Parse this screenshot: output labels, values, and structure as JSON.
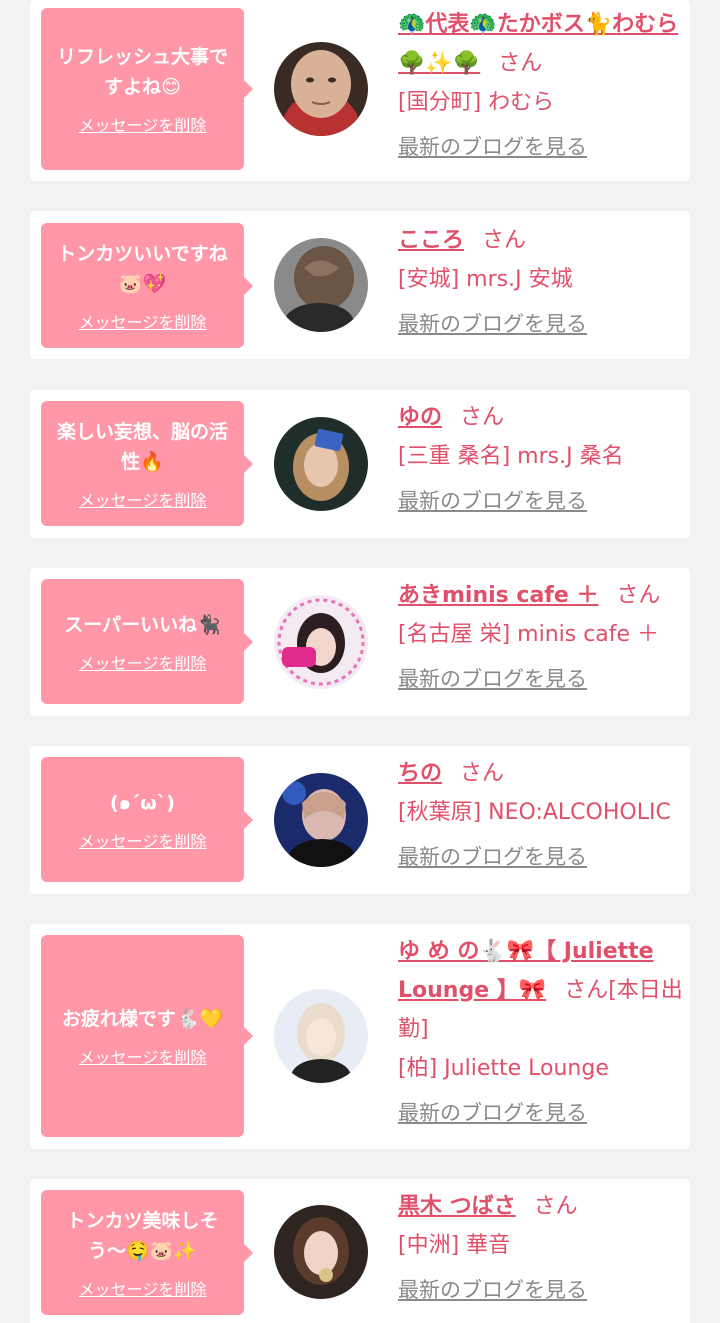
{
  "cards": [
    {
      "message": "リフレッシュ大事ですよね😊",
      "delete_label": "メッセージを削除",
      "name": "🦚代表🦚たかボス🐈わむら🌳✨🌳",
      "honorific": "さん",
      "shop": "[国分町] わむら",
      "blog_label": "最新のブログを見る",
      "avatar_icon": "avatar-photo"
    },
    {
      "message": "トンカツいいですね🐷💖",
      "delete_label": "メッセージを削除",
      "name": "こころ",
      "honorific": "さん",
      "shop": "[安城] mrs.J 安城",
      "blog_label": "最新のブログを見る",
      "avatar_icon": "avatar-photo"
    },
    {
      "message": "楽しい妄想、脳の活性🔥",
      "delete_label": "メッセージを削除",
      "name": "ゆの",
      "honorific": "さん",
      "shop": "[三重 桑名] mrs.J 桑名",
      "blog_label": "最新のブログを見る",
      "avatar_icon": "avatar-photo"
    },
    {
      "message": "スーパーいいね🐈‍⬛",
      "delete_label": "メッセージを削除",
      "name": "あきminis cafe ＋",
      "honorific": "さん",
      "shop": "[名古屋 栄] minis cafe ＋",
      "blog_label": "最新のブログを見る",
      "avatar_icon": "avatar-photo"
    },
    {
      "message": "(๑´ω`)",
      "delete_label": "メッセージを削除",
      "name": "ちの",
      "honorific": "さん",
      "shop": "[秋葉原] NEO:ALCOHOLIC",
      "blog_label": "最新のブログを見る",
      "avatar_icon": "avatar-photo"
    },
    {
      "message": "お疲れ様です🐇💛",
      "delete_label": "メッセージを削除",
      "name": "ゆ め の🐇🎀【 Juliette Lounge 】🎀",
      "honorific": "さん[本日出勤]",
      "shop": "[柏] Juliette Lounge",
      "blog_label": "最新のブログを見る",
      "avatar_icon": "avatar-photo"
    },
    {
      "message": "トンカツ美味しそう〜🤤🐷✨",
      "delete_label": "メッセージを削除",
      "name": "黒木 つばさ",
      "honorific": "さん",
      "shop": "[中洲] 華音",
      "blog_label": "最新のブログを見る",
      "avatar_icon": "avatar-photo"
    }
  ],
  "colors": {
    "page_bg": "#f2f2f2",
    "card_bg": "#ffffff",
    "bubble_pink": "#ff97a8",
    "accent_pink": "#e0506b",
    "link_gray": "#8a8a8a"
  }
}
